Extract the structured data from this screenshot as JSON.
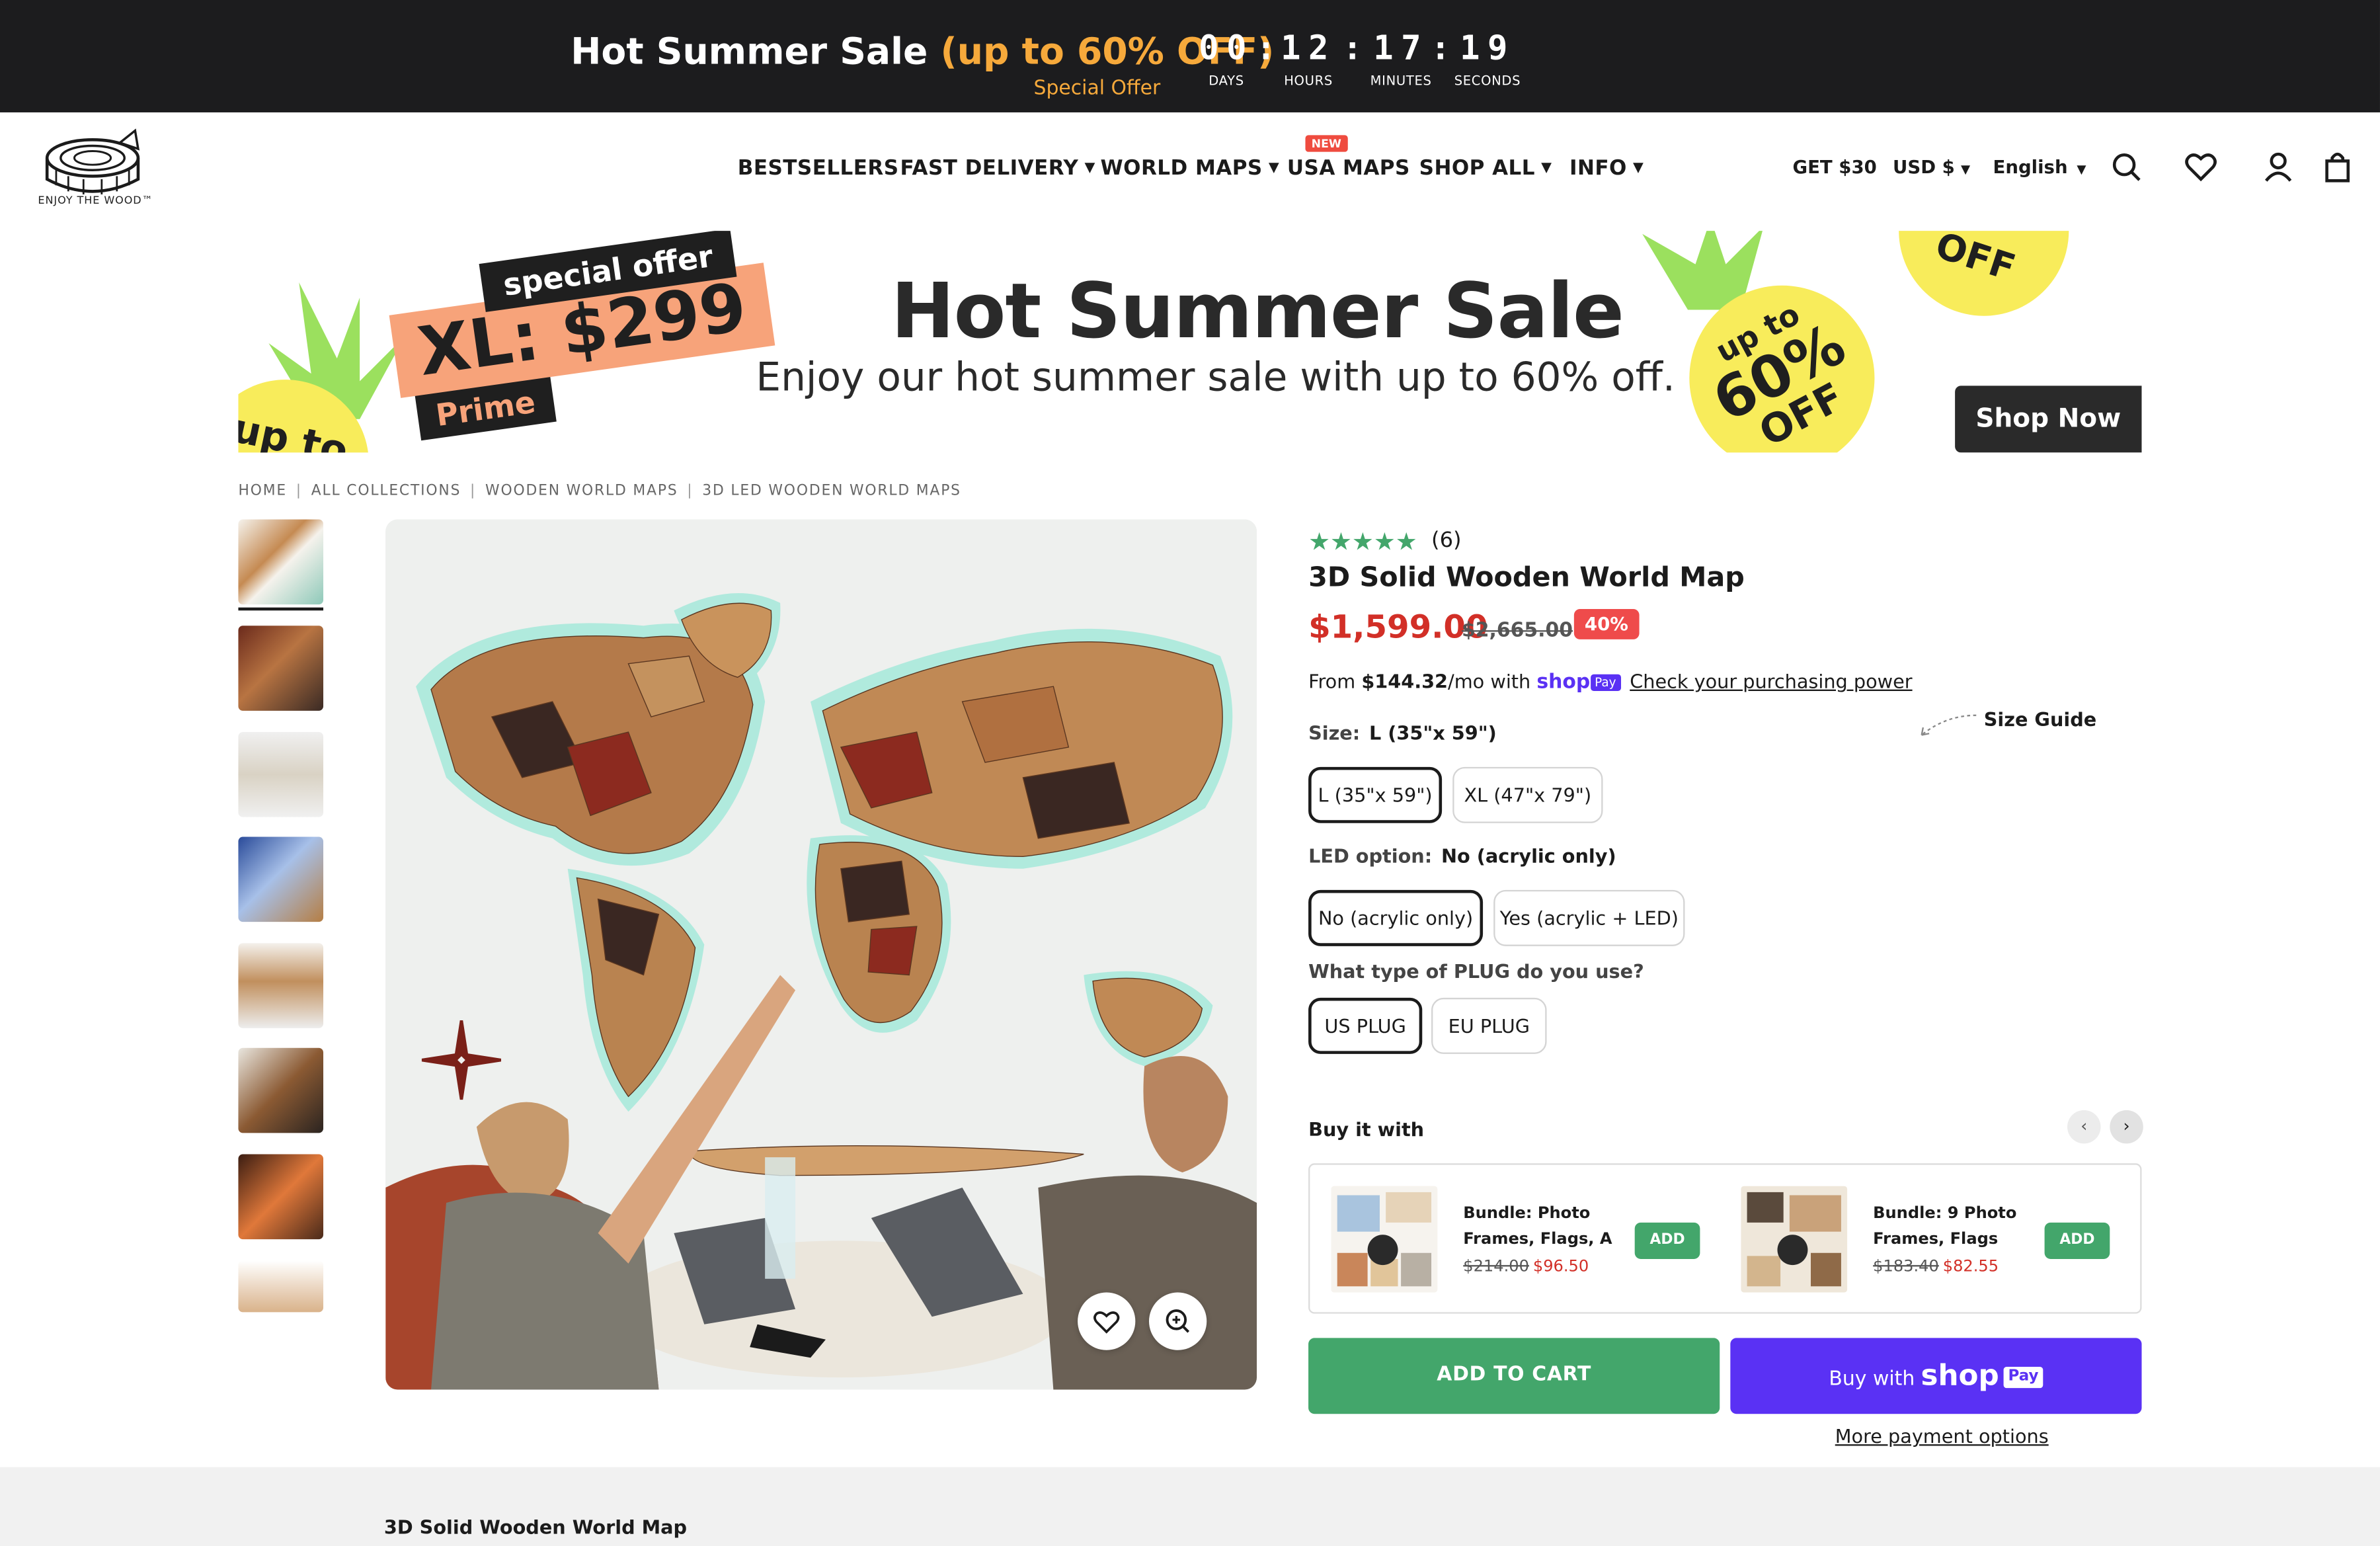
{
  "promo_bar": {
    "title_main": "Hot Summer Sale ",
    "title_highlight": "(up to 60% OFF)",
    "subtitle": "Special Offer",
    "countdown": [
      {
        "value": "00",
        "label": "DAYS"
      },
      {
        "value": "12",
        "label": "HOURS"
      },
      {
        "value": "17",
        "label": "MINUTES"
      },
      {
        "value": "19",
        "label": "SECONDS"
      }
    ]
  },
  "brand": {
    "tagline": "ENJOY THE WOOD™"
  },
  "nav": {
    "items": [
      "BESTSELLERS",
      "FAST DELIVERY",
      "WORLD MAPS",
      "USA MAPS",
      "SHOP ALL",
      "INFO"
    ],
    "new_badge": "NEW",
    "get_offer": "GET $30",
    "currency": "USD $",
    "language": "English"
  },
  "banner": {
    "special_offer": "special offer",
    "xl_price": "XL: $299",
    "prime": "Prime",
    "title": "Hot Summer Sale",
    "subtitle": "Enjoy our hot summer sale with up to 60% off.",
    "sticker_up_to": "up to",
    "sticker_pct": "60%",
    "sticker_off": "OFF",
    "sticker_partial_left": "up to",
    "sticker_partial_top": "OFF",
    "shop_now": "Shop Now"
  },
  "breadcrumb": [
    "HOME",
    "ALL COLLECTIONS",
    "WOODEN WORLD MAPS",
    "3D LED WOODEN WORLD MAPS"
  ],
  "product": {
    "stars": "★★★★★",
    "rating": 5,
    "review_count": "(6)",
    "title": "3D Solid Wooden World Map",
    "price": "$1,599.00",
    "compare_price": "$2,665.00",
    "discount_badge": "40%",
    "installment_prefix": "From ",
    "installment_amount": "$144.32",
    "installment_suffix": "/mo with ",
    "shop_logo": "shop",
    "shop_pay": "Pay",
    "purchasing_power_link": "Check your purchasing power",
    "size_label": "Size:",
    "size_value": "L (35\"x 59\")",
    "size_guide": "Size Guide",
    "sizes": [
      "L (35\"x 59\")",
      "XL (47\"x 79\")"
    ],
    "led_label": "LED option:",
    "led_value": "No (acrylic only)",
    "led_options": [
      "No (acrylic only)",
      "Yes (acrylic + LED)"
    ],
    "plug_label": "What type of PLUG do you use?",
    "plugs": [
      "US PLUG",
      "EU PLUG"
    ]
  },
  "buy_it_with": {
    "label": "Buy it with",
    "bundles": [
      {
        "name": "Bundle: Photo Frames, Flags, A",
        "old_price": "$214.00",
        "new_price": "$96.50",
        "add": "ADD"
      },
      {
        "name": "Bundle: 9 Photo Frames, Flags",
        "old_price": "$183.40",
        "new_price": "$82.55",
        "add": "ADD"
      }
    ]
  },
  "cta": {
    "add_to_cart": "ADD TO CART",
    "buy_with": "Buy with",
    "shop": "shop",
    "pay": "Pay",
    "more_payment": "More payment options"
  },
  "footer": {
    "title": "3D Solid Wooden World Map"
  },
  "colors": {
    "accent_green": "#43a66b",
    "sale_red": "#d22f27",
    "shop_purple": "#5a31f4",
    "promo_orange": "#f6a93b",
    "sticker_yellow": "#f8ec5b",
    "offer_peach": "#f7a37a"
  }
}
